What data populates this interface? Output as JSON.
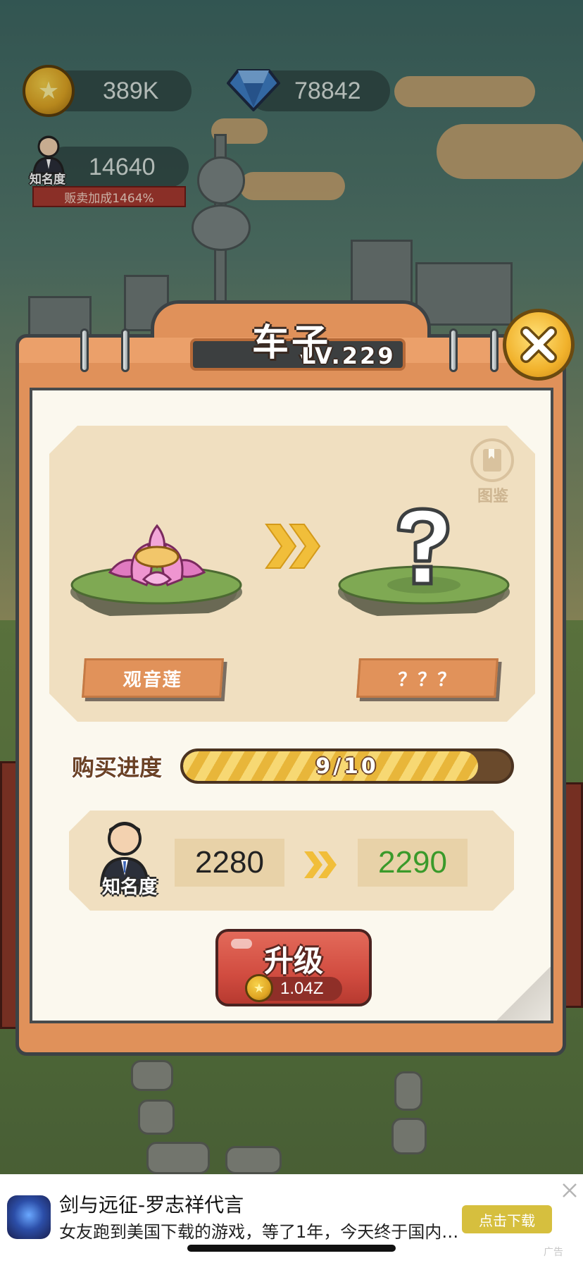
{
  "hud": {
    "coins": "389K",
    "gems": "78842",
    "fame_value": "14640",
    "fame_label": "知名度",
    "sell_bonus": "贩卖加成1464%"
  },
  "dialog": {
    "title": "车子",
    "level": "LV.229",
    "codex_label": "图鉴",
    "current_item": "观音莲",
    "next_item": "？？？",
    "progress_label": "购买进度",
    "progress_text": "9/10",
    "progress_value": 0.9,
    "fame_label": "知名度",
    "fame_current": "2280",
    "fame_next": "2290",
    "upgrade_label": "升级",
    "upgrade_cost": "1.04Z"
  },
  "ad": {
    "title": "剑与远征-罗志祥代言",
    "description": "女友跑到美国下载的游戏，等了1年，今天终于国内…",
    "button": "点击下载",
    "tag": "广告"
  },
  "icons": [
    "coin-icon",
    "gem-icon",
    "fame-avatar-icon",
    "close-icon",
    "codex-book-icon",
    "lotus-icon",
    "question-mark-icon",
    "double-arrow-icon"
  ],
  "colors": {
    "accent_orange": "#e0915a",
    "upgrade_red": "#d14c40",
    "next_value_green": "#3a9a2a",
    "ad_button": "#d6bf3e"
  }
}
